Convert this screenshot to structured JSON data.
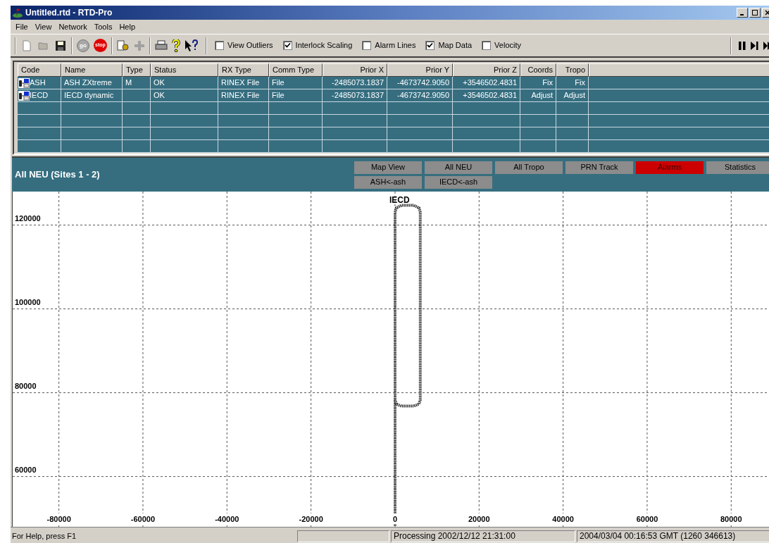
{
  "window": {
    "title": "Untitled.rtd - RTD-Pro"
  },
  "menu": [
    "File",
    "View",
    "Network",
    "Tools",
    "Help"
  ],
  "toolbar": {
    "go_label": "go",
    "stop_label": "stop",
    "options": [
      {
        "label": "View Outliers",
        "checked": false
      },
      {
        "label": "Interlock Scaling",
        "checked": true
      },
      {
        "label": "Alarm Lines",
        "checked": false
      },
      {
        "label": "Map Data",
        "checked": true
      },
      {
        "label": "Velocity",
        "checked": false
      }
    ]
  },
  "table": {
    "columns": [
      {
        "label": "Code"
      },
      {
        "label": "Name"
      },
      {
        "label": "Type"
      },
      {
        "label": "Status"
      },
      {
        "label": "RX Type"
      },
      {
        "label": "Comm Type"
      },
      {
        "label": "Prior X"
      },
      {
        "label": "Prior Y"
      },
      {
        "label": "Prior Z"
      },
      {
        "label": "Coords"
      },
      {
        "label": "Tropo"
      }
    ],
    "rows": [
      [
        "ASH",
        "ASH ZXtreme",
        "M",
        "OK",
        "RINEX File",
        "File",
        "-2485073.1837",
        "-4673742.9050",
        "+3546502.4831",
        "Fix",
        "Fix"
      ],
      [
        "IECD",
        "IECD dynamic",
        "",
        "OK",
        "RINEX File",
        "File",
        "-2485073.1837",
        "-4673742.9050",
        "+3546502.4831",
        "Adjust",
        "Adjust"
      ]
    ]
  },
  "plot_panel": {
    "title": "All NEU (Sites 1 - 2)",
    "buttons_row_1": [
      {
        "label": "Map View",
        "alarm": false
      },
      {
        "label": "All NEU",
        "alarm": false
      },
      {
        "label": "All Tropo",
        "alarm": false
      },
      {
        "label": "PRN Track",
        "alarm": false
      },
      {
        "label": "Alarms",
        "alarm": true
      },
      {
        "label": "Statistics",
        "alarm": false
      }
    ],
    "buttons_row_2": [
      {
        "label": "ASH<-ash",
        "alarm": false
      },
      {
        "label": "IECD<-ash",
        "alarm": false
      }
    ],
    "chart_data": {
      "type": "line",
      "grid": true,
      "xlim": [
        -91000,
        89000
      ],
      "ylim": [
        48000,
        128000
      ],
      "xticks": [
        -80000,
        -60000,
        -40000,
        -20000,
        0,
        20000,
        40000,
        60000,
        80000
      ],
      "yticks": [
        60000,
        80000,
        100000,
        120000
      ],
      "x": [
        0,
        0,
        300,
        1500,
        4500,
        5700,
        6000,
        6000,
        5700,
        4500,
        1500,
        300,
        0
      ],
      "series": [
        {
          "name": "IECD",
          "color": "#333333",
          "line_style": "dashed",
          "values": [
            48300,
            123100,
            124100,
            124700,
            124700,
            124100,
            123100,
            78300,
            77300,
            76800,
            76800,
            77300,
            78300
          ]
        }
      ]
    }
  },
  "status_bar": [
    "For Help, press F1",
    "Processing 2002/12/12 21:31:00",
    "2004/03/04 00:16:53 GMT (1260 346613)"
  ]
}
